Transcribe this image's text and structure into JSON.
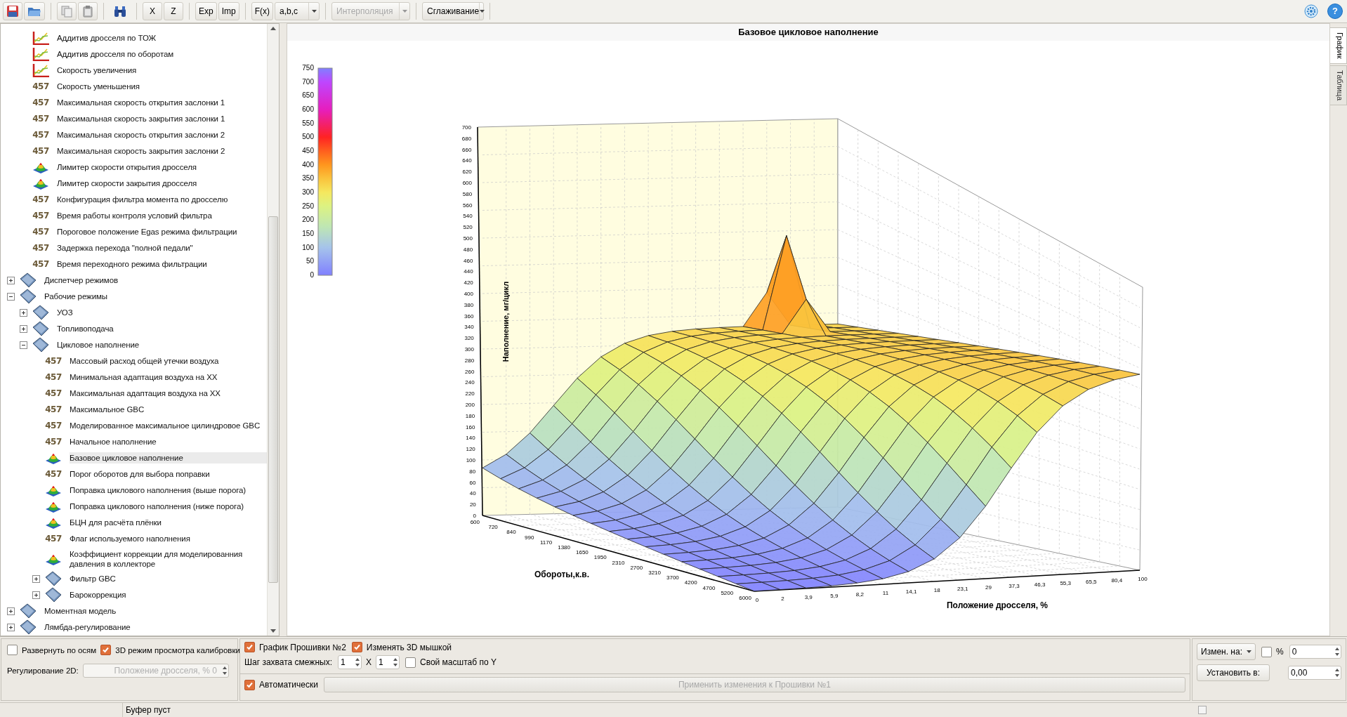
{
  "toolbar": {
    "axis_buttons": [
      "X",
      "Z"
    ],
    "io_buttons": [
      "Exp",
      "Imp"
    ],
    "function_button": "F(x)",
    "format_dropdown": "a,b,c",
    "dropdowns": [
      {
        "label": "Интерполяция",
        "disabled": true
      },
      {
        "label": "Сглаживание",
        "disabled": false
      }
    ],
    "help_button": "?"
  },
  "tree": {
    "continued_items": [
      {
        "label": "Аддитив дросселя по ТОЖ",
        "kind": "chart",
        "selected": false
      },
      {
        "label": "Аддитив дросселя по оборотам",
        "kind": "chart",
        "selected": false
      },
      {
        "label": "Скорость увеличения",
        "kind": "chart",
        "selected": false
      },
      {
        "label": "Скорость уменьшения",
        "kind": "number",
        "badge": "457",
        "selected": false
      },
      {
        "label": "Максимальная скорость открытия заслонки 1",
        "kind": "number",
        "badge": "457",
        "selected": false
      },
      {
        "label": "Максимальная скорость закрытия заслонки 1",
        "kind": "number",
        "badge": "457",
        "selected": false
      },
      {
        "label": "Максимальная скорость открытия заслонки 2",
        "kind": "number",
        "badge": "457",
        "selected": false
      },
      {
        "label": "Максимальная скорость закрытия заслонки 2",
        "kind": "number",
        "badge": "457",
        "selected": false
      },
      {
        "label": "Лимитер скорости открытия дросселя",
        "kind": "surface",
        "selected": false
      },
      {
        "label": "Лимитер скорости закрытия дросселя",
        "kind": "surface",
        "selected": false
      },
      {
        "label": "Конфигурация фильтра момента по дросселю",
        "kind": "number",
        "badge": "457",
        "selected": false
      },
      {
        "label": "Время работы контроля условий фильтра",
        "kind": "number",
        "badge": "457",
        "selected": false
      },
      {
        "label": "Пороговое положение Egas режима фильтрации",
        "kind": "number",
        "badge": "457",
        "selected": false
      },
      {
        "label": "Задержка перехода \"полной педали\"",
        "kind": "number",
        "badge": "457",
        "selected": false
      },
      {
        "label": "Время переходного режима фильтрации",
        "kind": "number",
        "badge": "457",
        "selected": false
      }
    ],
    "items": [
      {
        "label": "Диспетчер режимов",
        "kind": "folder",
        "expanded": false,
        "selected": false
      },
      {
        "label": "Рабочие режимы",
        "kind": "folder",
        "expanded": true,
        "selected": false,
        "children": [
          {
            "label": "УОЗ",
            "kind": "folder",
            "expanded": false,
            "selected": false
          },
          {
            "label": "Топливоподача",
            "kind": "folder",
            "expanded": false,
            "selected": false
          },
          {
            "label": "Цикловое наполнение",
            "kind": "folder",
            "expanded": true,
            "selected": false,
            "children": [
              {
                "label": "Массовый расход общей утечки воздуха",
                "kind": "number",
                "badge": "457",
                "selected": false
              },
              {
                "label": "Минимальная адаптация воздуха на ХХ",
                "kind": "number",
                "badge": "457",
                "selected": false
              },
              {
                "label": "Максимальная адаптация воздуха на ХХ",
                "kind": "number",
                "badge": "457",
                "selected": false
              },
              {
                "label": "Максимальное GBC",
                "kind": "number",
                "badge": "457",
                "selected": false
              },
              {
                "label": "Моделированное максимальное цилиндровое GBC",
                "kind": "number",
                "badge": "457",
                "selected": false
              },
              {
                "label": "Начальное наполнение",
                "kind": "number",
                "badge": "457",
                "selected": false
              },
              {
                "label": "Базовое цикловое наполнение",
                "kind": "surface",
                "selected": true
              },
              {
                "label": "Порог оборотов для выбора поправки",
                "kind": "number",
                "badge": "457",
                "selected": false
              },
              {
                "label": "Поправка циклового наполнения (выше порога)",
                "kind": "surface",
                "selected": false
              },
              {
                "label": "Поправка циклового наполнения (ниже порога)",
                "kind": "surface",
                "selected": false
              },
              {
                "label": "БЦН для расчёта плёнки",
                "kind": "surface",
                "selected": false
              },
              {
                "label": "Флаг используемого наполнения",
                "kind": "number",
                "badge": "457",
                "selected": false
              },
              {
                "label": "Коэффициент коррекции для моделированния давления в коллекторе",
                "kind": "surface",
                "selected": false
              },
              {
                "label": "Фильтр GBC",
                "kind": "folder",
                "expanded": false,
                "selected": false
              },
              {
                "label": "Барокоррекция",
                "kind": "folder",
                "expanded": false,
                "selected": false
              }
            ]
          }
        ]
      },
      {
        "label": "Моментная модель",
        "kind": "folder",
        "expanded": false,
        "selected": false
      },
      {
        "label": "Лямбда-регулирование",
        "kind": "folder",
        "expanded": false,
        "selected": false
      }
    ]
  },
  "chart": {
    "title": "Базовое цикловое наполнение",
    "colorbar_ticks": [
      "750",
      "700",
      "650",
      "600",
      "550",
      "500",
      "450",
      "400",
      "350",
      "300",
      "250",
      "200",
      "150",
      "100",
      "50",
      "0"
    ],
    "z_label": "Наполнение, мг/цикл",
    "z_ticks": [
      "700",
      "680",
      "660",
      "640",
      "620",
      "600",
      "580",
      "560",
      "540",
      "520",
      "500",
      "480",
      "460",
      "440",
      "420",
      "400",
      "380",
      "360",
      "340",
      "320",
      "300",
      "280",
      "260",
      "240",
      "220",
      "200",
      "180",
      "160",
      "140",
      "120",
      "100",
      "80",
      "60",
      "40",
      "20",
      "0"
    ],
    "x_label": "Обороты,к.в.",
    "x_ticks": [
      "600",
      "720",
      "840",
      "990",
      "1170",
      "1380",
      "1650",
      "1950",
      "2310",
      "2700",
      "3210",
      "3700",
      "4200",
      "4700",
      "5200",
      "6000"
    ],
    "y_label": "Положение дросселя, %",
    "y_ticks": [
      "0",
      "2",
      "3,9",
      "5,9",
      "8,2",
      "11",
      "14,1",
      "18",
      "23,1",
      "29",
      "37,3",
      "46,3",
      "55,3",
      "65,5",
      "80,4",
      "100"
    ]
  },
  "side_tabs": [
    {
      "label": "График",
      "selected": true
    },
    {
      "label": "Таблица",
      "selected": false
    }
  ],
  "bottom": {
    "view_options": [
      {
        "label": "Развернуть по осям",
        "checked": false
      },
      {
        "label": "3D режим просмотра калибровки",
        "checked": true
      }
    ],
    "regulation_2d": {
      "label": "Регулирование 2D:",
      "placeholder": "Положение дросселя, % 0",
      "disabled": true
    },
    "graph_options": [
      {
        "label": "График Прошивки №2",
        "checked": true
      },
      {
        "label": "Изменять 3D мышкой",
        "checked": true
      }
    ],
    "step": {
      "label": "Шаг захвата смежных:",
      "value_1": "1",
      "separator": "X",
      "value_2": "1"
    },
    "own_scale": {
      "label": "Свой масштаб по Y",
      "checked": false
    },
    "auto": {
      "label": "Автоматически",
      "checked": true
    },
    "apply_button": {
      "label": "Применить изменения к Прошивки №1",
      "disabled": true
    },
    "change": {
      "dropdown": "Измен. на:",
      "percent": {
        "label": "%",
        "checked": false
      },
      "value": "0",
      "set_button": "Установить в:",
      "set_value": "0,00"
    }
  },
  "status_bar": {
    "text": "Буфер пуст"
  }
}
